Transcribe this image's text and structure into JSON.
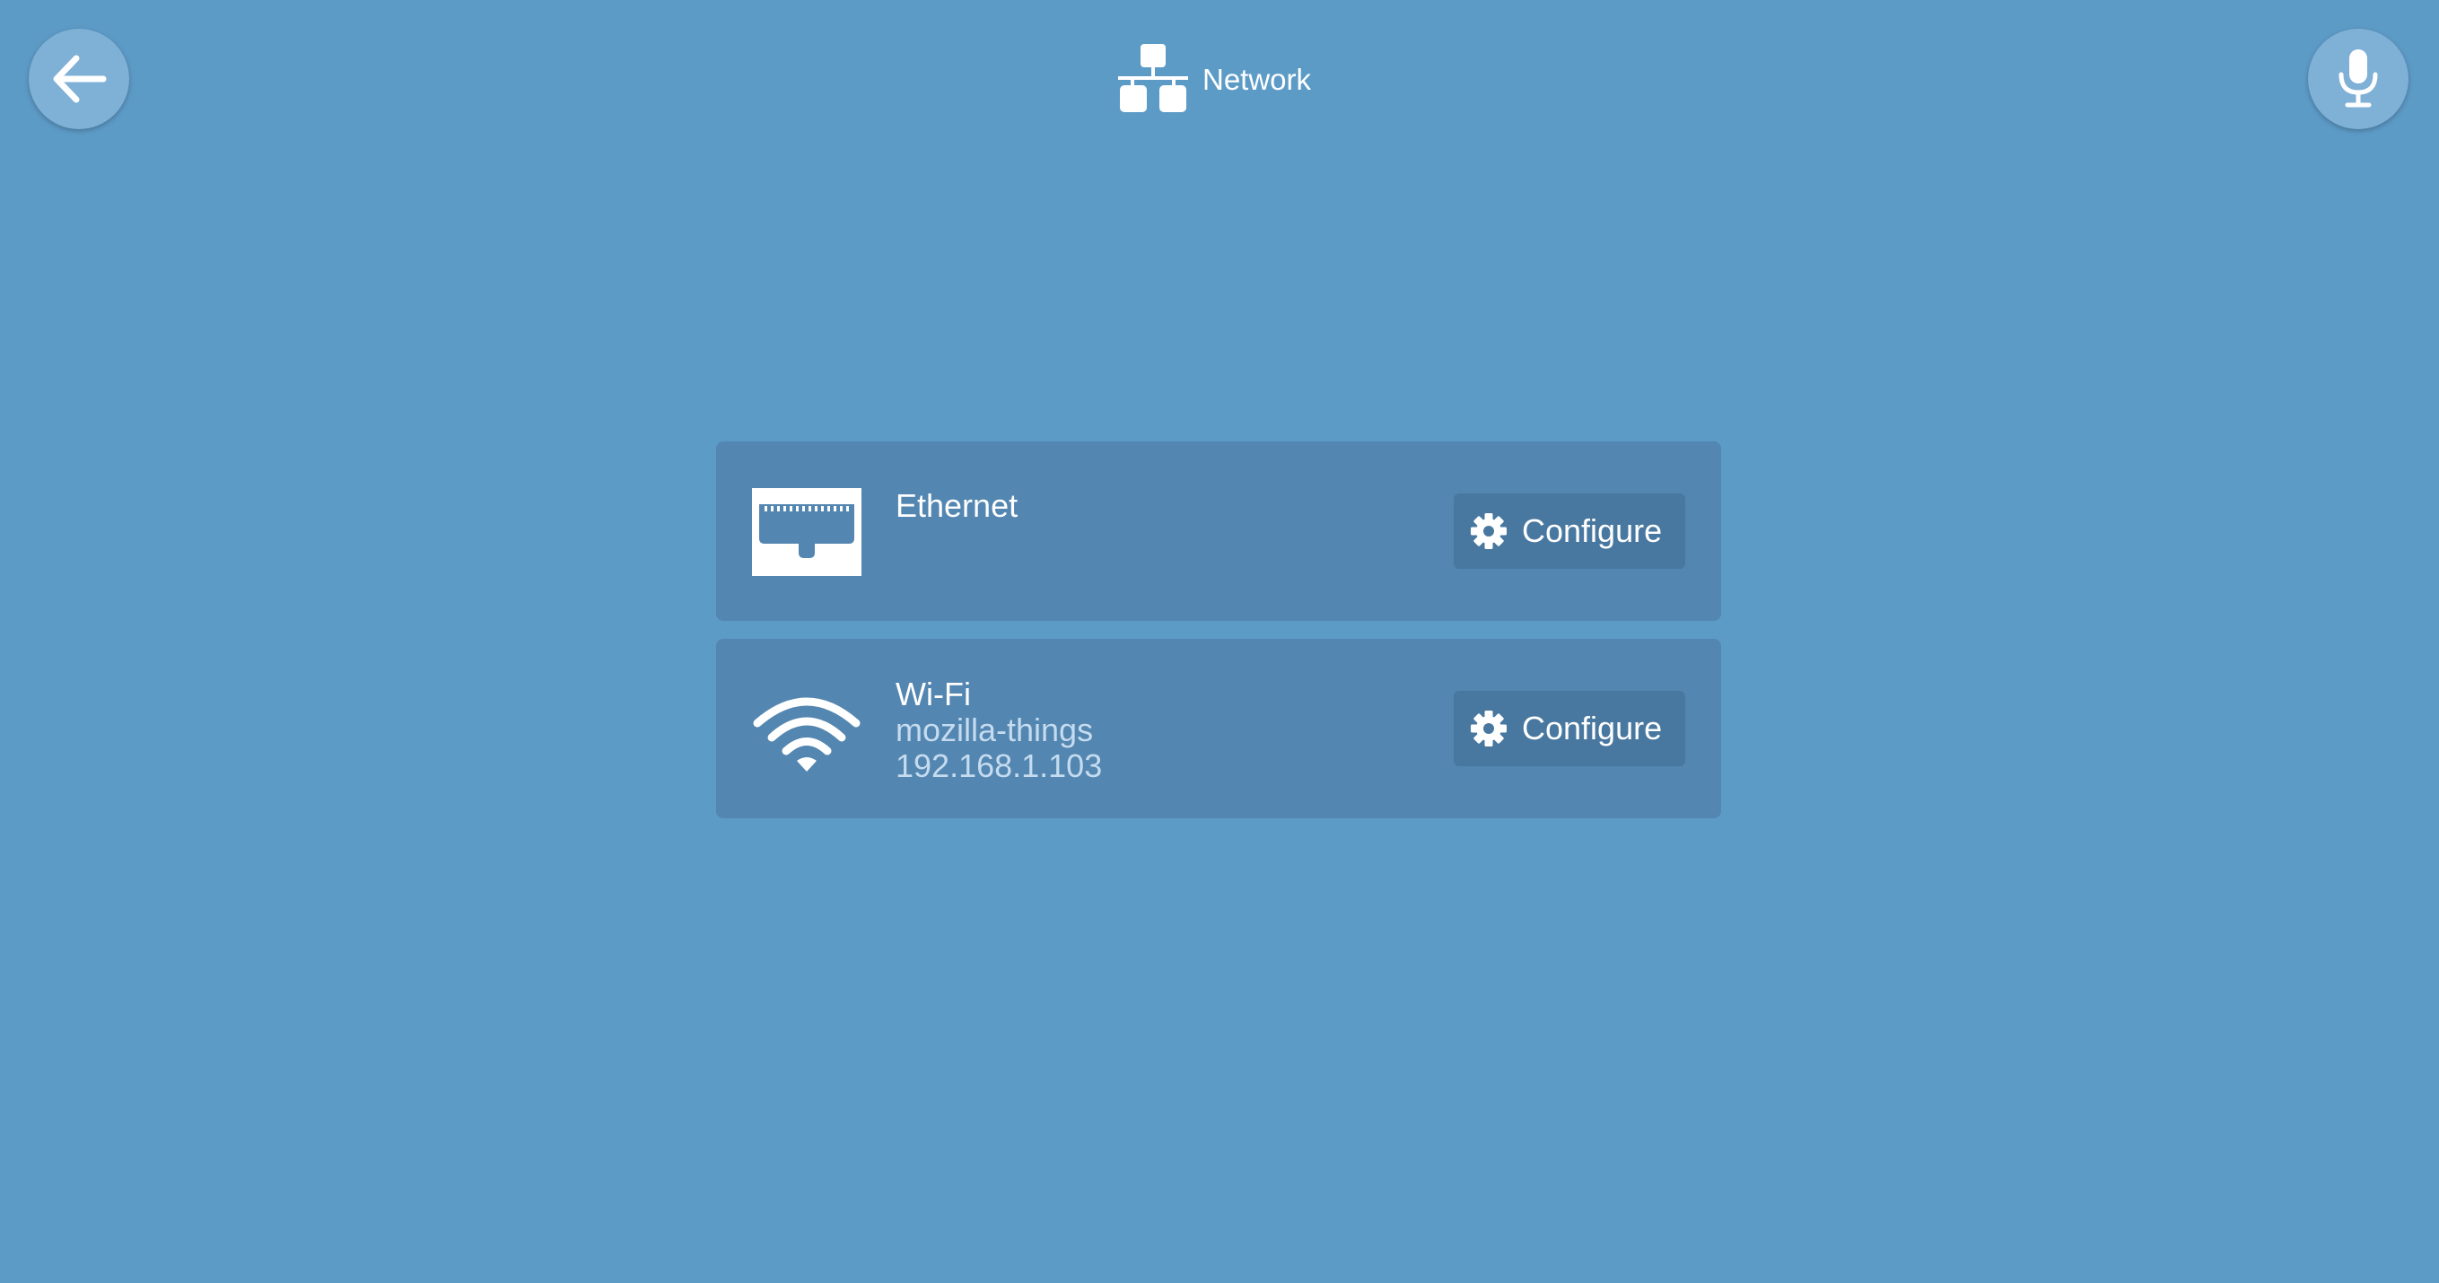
{
  "header": {
    "title": "Network",
    "back_icon": "arrow-left-icon",
    "mic_icon": "microphone-icon",
    "title_icon": "network-icon"
  },
  "connections": [
    {
      "name": "Ethernet",
      "icon": "ethernet-port-icon",
      "configure_label": "Configure"
    },
    {
      "name": "Wi-Fi",
      "icon": "wifi-icon",
      "network_name": "mozilla-things",
      "ip_address": "192.168.1.103",
      "configure_label": "Configure"
    }
  ],
  "colors": {
    "background": "#5d9bc7",
    "card": "#5386b0",
    "button": "#4878a0",
    "round_button": "#7fb0d6",
    "secondary_text": "#c5dbef"
  }
}
